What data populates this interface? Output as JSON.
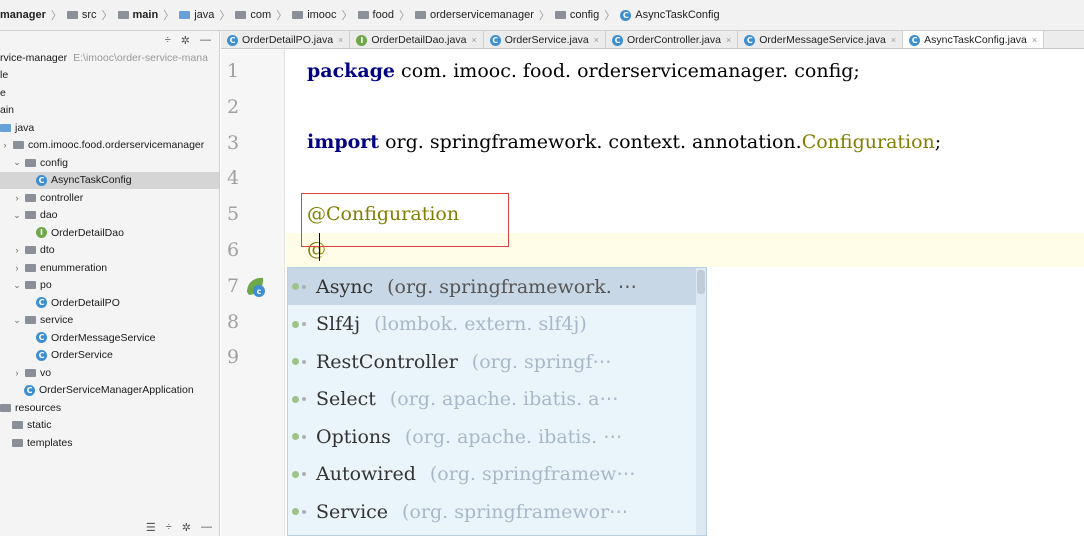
{
  "breadcrumb": [
    {
      "label": "manager",
      "bold": true,
      "icon": ""
    },
    {
      "label": "src",
      "bold": false,
      "icon": "folder"
    },
    {
      "label": "main",
      "bold": true,
      "icon": "folder"
    },
    {
      "label": "java",
      "bold": false,
      "icon": "folder-blue"
    },
    {
      "label": "com",
      "bold": false,
      "icon": "folder"
    },
    {
      "label": "imooc",
      "bold": false,
      "icon": "folder"
    },
    {
      "label": "food",
      "bold": false,
      "icon": "folder"
    },
    {
      "label": "orderservicemanager",
      "bold": false,
      "icon": "folder"
    },
    {
      "label": "config",
      "bold": false,
      "icon": "folder"
    },
    {
      "label": "AsyncTaskConfig",
      "bold": false,
      "icon": "class"
    }
  ],
  "project_toolbar": {
    "collapse": "÷",
    "settings": "✲",
    "hide": "—"
  },
  "tree": [
    {
      "label": "rvice-manager",
      "extra": "E:\\imooc\\order-service-mana",
      "indent": 0,
      "chev": "",
      "icon": ""
    },
    {
      "label": "le",
      "indent": 0,
      "chev": "",
      "icon": ""
    },
    {
      "label": "e",
      "indent": 0,
      "chev": "",
      "icon": ""
    },
    {
      "label": "ain",
      "indent": 0,
      "chev": "",
      "icon": ""
    },
    {
      "label": "java",
      "indent": 0,
      "chev": "",
      "icon": "folder-blue"
    },
    {
      "label": "com.imooc.food.orderservicemanager",
      "indent": 0,
      "chev": "›",
      "icon": "folder"
    },
    {
      "label": "config",
      "indent": 1,
      "chev": "⌄",
      "icon": "folder"
    },
    {
      "label": "AsyncTaskConfig",
      "indent": 3,
      "chev": "",
      "icon": "class",
      "selected": true
    },
    {
      "label": "controller",
      "indent": 1,
      "chev": "›",
      "icon": "folder"
    },
    {
      "label": "dao",
      "indent": 1,
      "chev": "⌄",
      "icon": "folder"
    },
    {
      "label": "OrderDetailDao",
      "indent": 3,
      "chev": "",
      "icon": "iface"
    },
    {
      "label": "dto",
      "indent": 1,
      "chev": "›",
      "icon": "folder"
    },
    {
      "label": "enummeration",
      "indent": 1,
      "chev": "›",
      "icon": "folder"
    },
    {
      "label": "po",
      "indent": 1,
      "chev": "⌄",
      "icon": "folder"
    },
    {
      "label": "OrderDetailPO",
      "indent": 3,
      "chev": "",
      "icon": "class"
    },
    {
      "label": "service",
      "indent": 1,
      "chev": "⌄",
      "icon": "folder"
    },
    {
      "label": "OrderMessageService",
      "indent": 3,
      "chev": "",
      "icon": "class"
    },
    {
      "label": "OrderService",
      "indent": 3,
      "chev": "",
      "icon": "class"
    },
    {
      "label": "vo",
      "indent": 1,
      "chev": "›",
      "icon": "folder"
    },
    {
      "label": "OrderServiceManagerApplication",
      "indent": 2,
      "chev": "",
      "icon": "class"
    },
    {
      "label": "resources",
      "indent": 0,
      "chev": "",
      "icon": "folder"
    },
    {
      "label": "static",
      "indent": 1,
      "chev": "",
      "icon": "folder"
    },
    {
      "label": "templates",
      "indent": 1,
      "chev": "",
      "icon": "folder"
    }
  ],
  "project_bottom": {
    "align": "☰",
    "collapse": "÷",
    "settings": "✲",
    "hide": "—"
  },
  "tabs": [
    {
      "label": "OrderDetailPO.java",
      "icon": "class",
      "active": false
    },
    {
      "label": "OrderDetailDao.java",
      "icon": "iface",
      "active": false
    },
    {
      "label": "OrderService.java",
      "icon": "class",
      "active": false
    },
    {
      "label": "OrderController.java",
      "icon": "class",
      "active": false
    },
    {
      "label": "OrderMessageService.java",
      "icon": "class",
      "active": false
    },
    {
      "label": "AsyncTaskConfig.java",
      "icon": "class",
      "active": true
    }
  ],
  "tab_close": "×",
  "line_numbers": [
    "1",
    "2",
    "3",
    "4",
    "5",
    "6",
    "7",
    "8",
    "9"
  ],
  "code": {
    "l1_kw": "package",
    "l1_rest": " com. imooc. food. orderservicemanager. config;",
    "l3_kw": "import",
    "l3_rest": " org. springframework. context. annotation.",
    "l3_ann": "Configuration",
    "l3_end": ";",
    "l5_ann": "@Configuration",
    "l6_ann": "@"
  },
  "suggestions": [
    {
      "name": "Async",
      "pkg": "(org. springframework. ⋯",
      "selected": true
    },
    {
      "name": "Slf4j",
      "pkg": "(lombok. extern. slf4j)",
      "selected": false
    },
    {
      "name": "RestController",
      "pkg": "(org. springf⋯",
      "selected": false
    },
    {
      "name": "Select",
      "pkg": "(org. apache. ibatis. a⋯",
      "selected": false
    },
    {
      "name": "Options",
      "pkg": "(org. apache. ibatis. ⋯",
      "selected": false
    },
    {
      "name": "Autowired",
      "pkg": "(org. springframew⋯",
      "selected": false
    },
    {
      "name": "Service",
      "pkg": "(org. springframewor⋯",
      "selected": false
    }
  ]
}
